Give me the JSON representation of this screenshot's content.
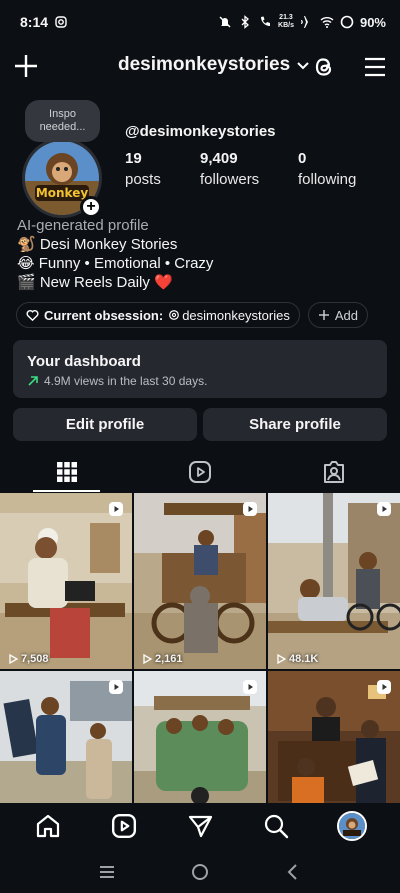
{
  "status_bar": {
    "time": "8:14",
    "net_speed_top": "21.3",
    "net_speed_bottom": "KB/s",
    "battery": "90%",
    "icons": [
      "instagram-notif-icon",
      "mute-icon",
      "bluetooth-icon",
      "wifi-call-icon",
      "airplane-icon",
      "wifi-icon",
      "battery-ring-icon"
    ]
  },
  "header": {
    "username": "desimonkeystories",
    "icons": [
      "plus-icon",
      "chevron-down-icon",
      "threads-icon",
      "menu-icon"
    ]
  },
  "profile": {
    "note": "Inspo needed...",
    "handle": "@desimonkeystories",
    "avatar_text": "Monkey",
    "stats": [
      {
        "value": "19",
        "label": "posts"
      },
      {
        "value": "9,409",
        "label": "followers"
      },
      {
        "value": "0",
        "label": "following"
      }
    ],
    "category": "AI-generated profile",
    "bio_lines": [
      "🐒 Desi Monkey Stories",
      "😂 Funny • Emotional • Crazy",
      "🎬 New Reels Daily ❤️"
    ]
  },
  "chips": {
    "obsession_label": "Current obsession:",
    "obsession_value": "desimonkeystories",
    "add_label": "Add"
  },
  "dashboard": {
    "title": "Your dashboard",
    "subtitle": "4.9M views in the last 30 days."
  },
  "buttons": {
    "edit": "Edit profile",
    "share": "Share profile"
  },
  "grid": {
    "posts": [
      {
        "views": "7,508",
        "scene": "tailor"
      },
      {
        "views": "2,161",
        "scene": "donkey-cart"
      },
      {
        "views": "48.1K",
        "scene": "charpai"
      },
      {
        "views": "",
        "scene": "solar-panel"
      },
      {
        "views": "",
        "scene": "rickshaw"
      },
      {
        "views": "",
        "scene": "courtroom"
      }
    ]
  },
  "colors": {
    "background": "#0c0f14",
    "card": "#25282e",
    "trend_up": "#3ddc84"
  }
}
